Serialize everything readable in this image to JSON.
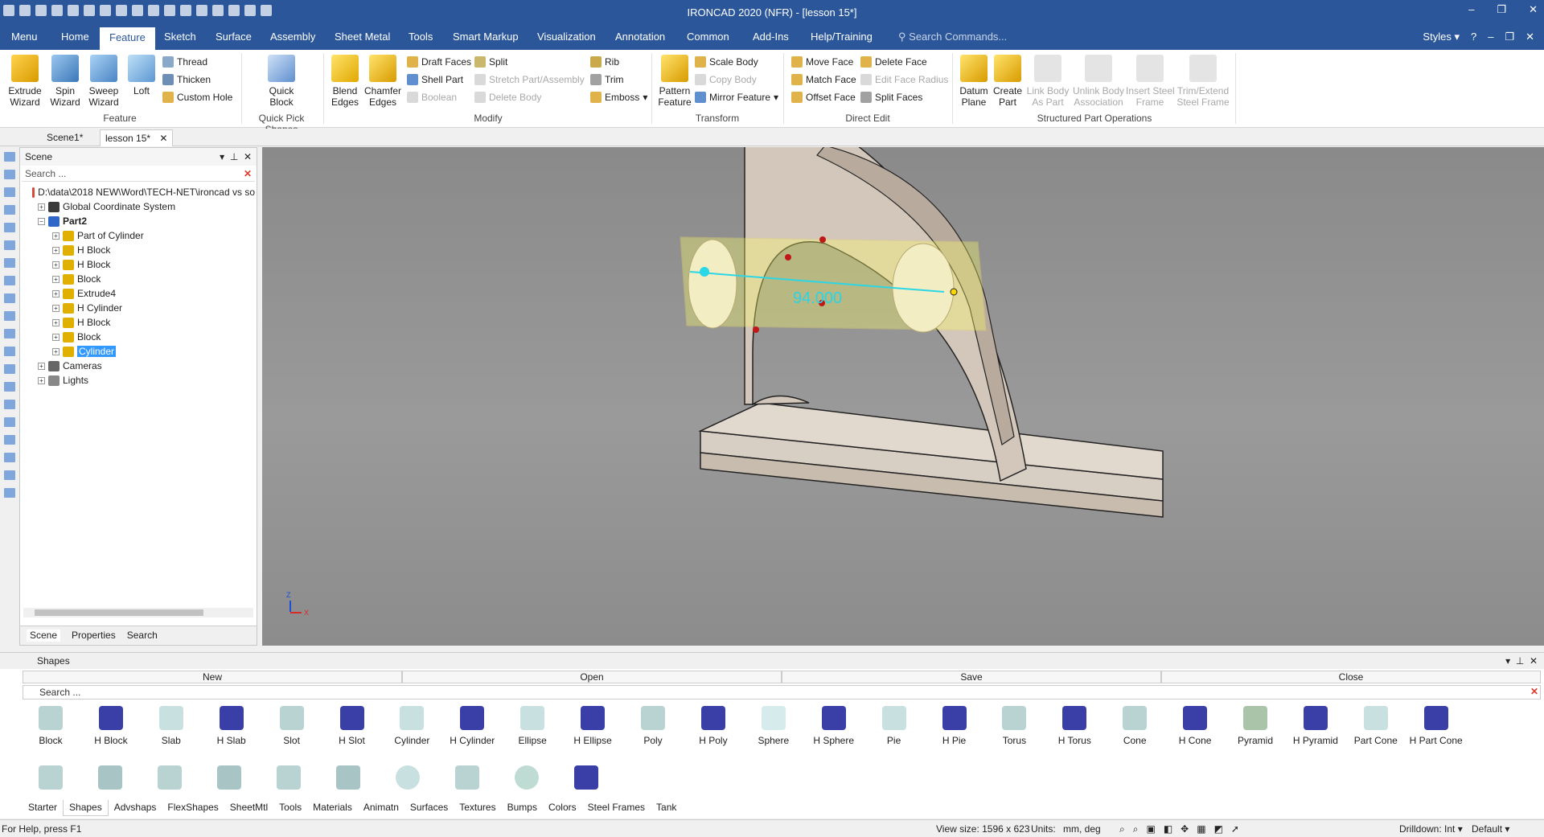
{
  "window": {
    "title": "IRONCAD 2020 (NFR) - [lesson 15*]",
    "controls": [
      "–",
      "❐",
      "✕"
    ]
  },
  "ribbon_tabs": [
    "Menu",
    "Home",
    "Feature",
    "Sketch",
    "Surface",
    "Assembly",
    "Sheet Metal",
    "Tools",
    "Smart Markup",
    "Visualization",
    "Annotation",
    "Common",
    "Add-Ins",
    "Help/Training"
  ],
  "search_commands": "Search Commands...",
  "styles_label": "Styles",
  "ribbon": {
    "feature": {
      "extrude": "Extrude\nWizard",
      "spin": "Spin\nWizard",
      "sweep": "Sweep\nWizard",
      "loft": "Loft",
      "thread": "Thread",
      "thicken": "Thicken",
      "custom_hole": "Custom Hole",
      "group": "Feature"
    },
    "quick": {
      "quick_block": "Quick\nBlock",
      "group": "Quick Pick Shapes"
    },
    "modify": {
      "blend": "Blend\nEdges",
      "chamfer": "Chamfer\nEdges",
      "draft": "Draft Faces",
      "shell": "Shell Part",
      "boolean": "Boolean",
      "split": "Split",
      "stretch": "Stretch Part/Assembly",
      "delete_body": "Delete Body",
      "rib": "Rib",
      "trim": "Trim",
      "emboss": "Emboss",
      "group": "Modify"
    },
    "transform": {
      "pattern": "Pattern\nFeature",
      "scale": "Scale Body",
      "copy": "Copy Body",
      "mirror": "Mirror Feature",
      "group": "Transform"
    },
    "direct": {
      "move_face": "Move Face",
      "match_face": "Match Face",
      "offset_face": "Offset Face",
      "delete_face": "Delete Face",
      "edit_radius": "Edit Face Radius",
      "split_faces": "Split Faces",
      "group": "Direct Edit"
    },
    "structured": {
      "datum": "Datum\nPlane",
      "create_part": "Create\nPart",
      "link_body": "Link Body\nAs Part",
      "unlink_body": "Unlink Body\nAssociation",
      "insert_steel": "Insert Steel\nFrame",
      "trim_steel": "Trim/Extend\nSteel Frame",
      "group": "Structured Part Operations"
    }
  },
  "doc_tabs": [
    "Scene1*",
    "lesson 15*"
  ],
  "scene": {
    "title": "Scene",
    "search_placeholder": "Search ...",
    "tree": [
      {
        "label": "D:\\data\\2018 NEW\\Word\\TECH-NET\\ironcad vs so",
        "level": 0,
        "icon": "root"
      },
      {
        "label": "Global Coordinate System",
        "level": 1,
        "icon": "axes"
      },
      {
        "label": "Part2",
        "level": 1,
        "icon": "part",
        "bold": true
      },
      {
        "label": "Part of Cylinder",
        "level": 2,
        "icon": "feature"
      },
      {
        "label": "H Block",
        "level": 2,
        "icon": "feature"
      },
      {
        "label": "H Block",
        "level": 2,
        "icon": "feature"
      },
      {
        "label": "Block",
        "level": 2,
        "icon": "feature"
      },
      {
        "label": "Extrude4",
        "level": 2,
        "icon": "feature"
      },
      {
        "label": "H Cylinder",
        "level": 2,
        "icon": "feature"
      },
      {
        "label": "H Block",
        "level": 2,
        "icon": "feature"
      },
      {
        "label": "Block",
        "level": 2,
        "icon": "feature"
      },
      {
        "label": "Cylinder",
        "level": 2,
        "icon": "feature",
        "selected": true
      },
      {
        "label": "Cameras",
        "level": 1,
        "icon": "camera"
      },
      {
        "label": "Lights",
        "level": 1,
        "icon": "light"
      }
    ],
    "tabs": [
      "Scene",
      "Properties",
      "Search"
    ]
  },
  "viewport": {
    "dimension": "94.000",
    "triad": {
      "z": "Z",
      "x": "X"
    }
  },
  "shapes": {
    "title": "Shapes",
    "actions": [
      "New",
      "Open",
      "Save",
      "Close"
    ],
    "search_placeholder": "Search ...",
    "items": [
      "Block",
      "H Block",
      "Slab",
      "H Slab",
      "Slot",
      "H Slot",
      "Cylinder",
      "H Cylinder",
      "Ellipse",
      "H Ellipse",
      "Poly",
      "H Poly",
      "Sphere",
      "H Sphere",
      "Pie",
      "H Pie",
      "Torus",
      "H Torus",
      "Cone",
      "H Cone",
      "Pyramid",
      "H Pyramid",
      "Part Cone",
      "H Part Cone"
    ],
    "catalogs": [
      "Starter",
      "Shapes",
      "Advshaps",
      "FlexShapes",
      "SheetMtl",
      "Tools",
      "Materials",
      "Animatn",
      "Surfaces",
      "Textures",
      "Bumps",
      "Colors",
      "Steel Frames",
      "Tank"
    ],
    "active_catalog": "Shapes"
  },
  "status": {
    "help": "For Help, press F1",
    "view_size": "View size: 1596 x  623",
    "units_label": "Units:",
    "units": "mm, deg",
    "drilldown": "Drilldown: Int",
    "default": "Default"
  },
  "colors": {
    "accent": "#2b579a",
    "selection": "#3399ff",
    "part": "#c8bcae",
    "highlight": "#ffff66"
  }
}
